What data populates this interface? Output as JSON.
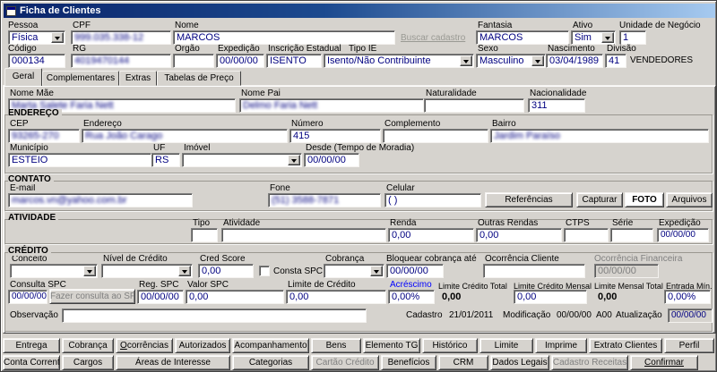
{
  "window": {
    "title": "Ficha de Clientes"
  },
  "colors": {
    "surface": "#d6d3ce",
    "field_text": "#000080",
    "titlebar_start": "#0a246a",
    "titlebar_end": "#a6caf0",
    "disabled_text": "#808080",
    "accent_label": "#0000ff"
  },
  "header": {
    "pessoa": {
      "label": "Pessoa",
      "value": "Física"
    },
    "cpf": {
      "label": "CPF",
      "value": "999.035.338-12",
      "redacted": true
    },
    "nome": {
      "label": "Nome",
      "value": "MARCOS"
    },
    "buscar_link": "Buscar cadastro",
    "fantasia": {
      "label": "Fantasia",
      "value": "MARCOS"
    },
    "ativo": {
      "label": "Ativo",
      "value": "Sim"
    },
    "unidade": {
      "label": "Unidade de Negócio",
      "value": "1"
    },
    "codigo": {
      "label": "Código",
      "value": "000134"
    },
    "rg": {
      "label": "RG",
      "value": "4019470144",
      "redacted": true
    },
    "orgao": {
      "label": "Orgão",
      "value": ""
    },
    "expedicao": {
      "label": "Expedição",
      "value": "00/00/00"
    },
    "inscricao_estadual": {
      "label": "Inscrição Estadual",
      "value": "ISENTO"
    },
    "tipo_ie": {
      "label": "Tipo IE",
      "value": "Isento/Não Contribuinte"
    },
    "sexo": {
      "label": "Sexo",
      "value": "Masculino"
    },
    "nascimento": {
      "label": "Nascimento",
      "value": "03/04/1989"
    },
    "divisao": {
      "label": "Divisão",
      "value": "41",
      "descricao": "VENDEDORES"
    }
  },
  "tabs": [
    {
      "label": "Geral",
      "active": true
    },
    {
      "label": "Complementares",
      "active": false
    },
    {
      "label": "Extras",
      "active": false
    },
    {
      "label": "Tabelas de Preço",
      "active": false
    }
  ],
  "geral": {
    "filiacao": {
      "nome_mae": {
        "label": "Nome Mãe",
        "value": "Marta Salete Faria Nett",
        "redacted": true
      },
      "nome_pai": {
        "label": "Nome Pai",
        "value": "Delmo Faria Nett",
        "redacted": true
      },
      "naturalidade": {
        "label": "Naturalidade",
        "value": ""
      },
      "nacionalidade": {
        "label": "Nacionalidade",
        "value": "311"
      }
    },
    "endereco": {
      "title": "ENDEREÇO",
      "cep": {
        "label": "CEP",
        "value": "93265-270",
        "redacted": true
      },
      "endereco": {
        "label": "Endereço",
        "value": "Rua João Carago",
        "redacted": true
      },
      "numero": {
        "label": "Número",
        "value": "415"
      },
      "complemento": {
        "label": "Complemento",
        "value": ""
      },
      "bairro": {
        "label": "Bairro",
        "value": "Jardim Paraíso",
        "redacted": true
      },
      "municipio": {
        "label": "Município",
        "value": "ESTEIO"
      },
      "uf": {
        "label": "UF",
        "value": "RS"
      },
      "imovel": {
        "label": "Imóvel",
        "value": ""
      },
      "desde": {
        "label": "Desde (Tempo de Moradia)",
        "value": "00/00/00"
      }
    },
    "contato": {
      "title": "CONTATO",
      "email": {
        "label": "E-mail",
        "value": "marcos.vn@yahoo.com.br",
        "redacted": true
      },
      "fone": {
        "label": "Fone",
        "value": "(51) 3588-7871",
        "redacted": true
      },
      "celular": {
        "label": "Celular",
        "value": "( )"
      },
      "referencias_button": "Referências",
      "capturar_button": "Capturar",
      "foto_panel": "FOTO",
      "arquivos_button": "Arquivos"
    },
    "atividade": {
      "title": "ATIVIDADE",
      "tipo": {
        "label": "Tipo",
        "value": ""
      },
      "atividade": {
        "label": "Atividade",
        "value": ""
      },
      "renda": {
        "label": "Renda",
        "value": "0,00"
      },
      "outras_rendas": {
        "label": "Outras Rendas",
        "value": "0,00"
      },
      "ctps": {
        "label": "CTPS",
        "value": ""
      },
      "serie": {
        "label": "Série",
        "value": ""
      },
      "expedicao": {
        "label": "Expedição",
        "value": "00/00/00"
      }
    },
    "credito": {
      "title": "CRÉDITO",
      "conceito": {
        "label": "Conceito",
        "value": ""
      },
      "nivel_credito": {
        "label": "Nível de Crédito",
        "value": ""
      },
      "cred_score": {
        "label": "Cred Score",
        "value": "0,00"
      },
      "consta_spc": {
        "label": "Consta SPC",
        "checked": false
      },
      "cobranca": {
        "label": "Cobrança",
        "value": ""
      },
      "bloquear_ate": {
        "label": "Bloquear cobrança até",
        "value": "00/00/00"
      },
      "ocorrencia_cliente": {
        "label": "Ocorrência Cliente",
        "value": ""
      },
      "ocorrencia_financeira": {
        "label": "Ocorrência Financeira",
        "value": "00/00/00",
        "disabled": true
      },
      "consulta_spc": {
        "label": "Consulta SPC",
        "value": "00/00/00"
      },
      "fazer_consulta_button": {
        "label": "Fazer consulta ao SPC",
        "enabled": false
      },
      "reg_spc": {
        "label": "Reg. SPC",
        "value": "00/00/00"
      },
      "valor_spc": {
        "label": "Valor SPC",
        "value": "0,00"
      },
      "limite_credito": {
        "label": "Limite de Crédito",
        "value": "0,00"
      },
      "acrescimo": {
        "label": "Acréscimo",
        "value": "0,00%"
      },
      "limite_credito_total": {
        "label": "Limite Crédito Total",
        "value": "0,00"
      },
      "limite_credito_mensal": {
        "label": "Limite Crédito Mensal",
        "value": "0,00"
      },
      "limite_mensal_total": {
        "label": "Limite Mensal Total",
        "value": "0,00"
      },
      "entrada_min": {
        "label": "Entrada Mín.",
        "value": "0,00%"
      },
      "observacao": {
        "label": "Observação",
        "value": ""
      },
      "cadastro": {
        "label": "Cadastro",
        "value": "21/01/2011"
      },
      "modificacao": {
        "label": "Modificação",
        "value": "00/00/00"
      },
      "versao": "A00",
      "atualizacao": {
        "label": "Atualização",
        "value": "00/00/00"
      }
    }
  },
  "bottom": {
    "row1": [
      {
        "label": "Entrega",
        "enabled": true
      },
      {
        "label": "Cobrança",
        "enabled": true
      },
      {
        "label": "Ocorrências",
        "enabled": true
      },
      {
        "label": "Autorizados",
        "enabled": true
      },
      {
        "label": "Acompanhamento",
        "enabled": true
      },
      {
        "label": "Bens",
        "enabled": true
      },
      {
        "label": "Elemento TG",
        "enabled": true
      },
      {
        "label": "Histórico",
        "enabled": true
      },
      {
        "label": "Limite",
        "enabled": true
      },
      {
        "label": "Imprime",
        "enabled": true
      },
      {
        "label": "Extrato Clientes",
        "enabled": true
      },
      {
        "label": "Perfil",
        "enabled": true
      }
    ],
    "row2": [
      {
        "label": "Conta Corrente",
        "enabled": true
      },
      {
        "label": "Cargos",
        "enabled": true
      },
      {
        "label": "Áreas de Interesse",
        "enabled": true
      },
      {
        "label": "Categorias",
        "enabled": true
      },
      {
        "label": "Cartão Crédito",
        "enabled": false
      },
      {
        "label": "Benefícios",
        "enabled": true
      },
      {
        "label": "CRM",
        "enabled": true
      },
      {
        "label": "Dados Legais",
        "enabled": true
      },
      {
        "label": "Cadastro Receitas",
        "enabled": false
      },
      {
        "label": "Confirmar",
        "enabled": true
      }
    ]
  }
}
